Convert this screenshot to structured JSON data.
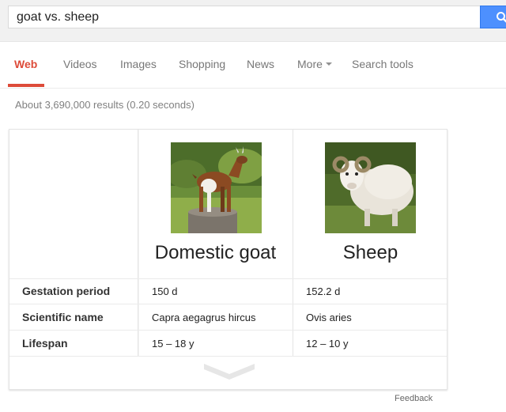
{
  "search": {
    "query": "goat vs. sheep",
    "button_icon": "search-icon"
  },
  "tabs": [
    {
      "label": "Web",
      "active": true
    },
    {
      "label": "Videos"
    },
    {
      "label": "Images"
    },
    {
      "label": "Shopping"
    },
    {
      "label": "News"
    },
    {
      "label": "More"
    },
    {
      "label": "Search tools"
    }
  ],
  "stats": "About 3,690,000 results (0.20 seconds)",
  "comparison": {
    "animals": [
      {
        "name": "Domestic goat",
        "photo": "goat-photo"
      },
      {
        "name": "Sheep",
        "photo": "sheep-photo"
      }
    ],
    "rows": [
      {
        "label": "Gestation period",
        "values": [
          "150 d",
          "152.2 d"
        ]
      },
      {
        "label": "Scientific name",
        "values": [
          "Capra aegagrus hircus",
          "Ovis aries"
        ]
      },
      {
        "label": "Lifespan",
        "values": [
          "15 – 18 y",
          "12 – 10 y"
        ]
      }
    ],
    "expand_icon": "chevron-down-icon"
  },
  "feedback": "Feedback",
  "colors": {
    "accent": "#dd4b39",
    "search_button": "#4d90fe"
  }
}
